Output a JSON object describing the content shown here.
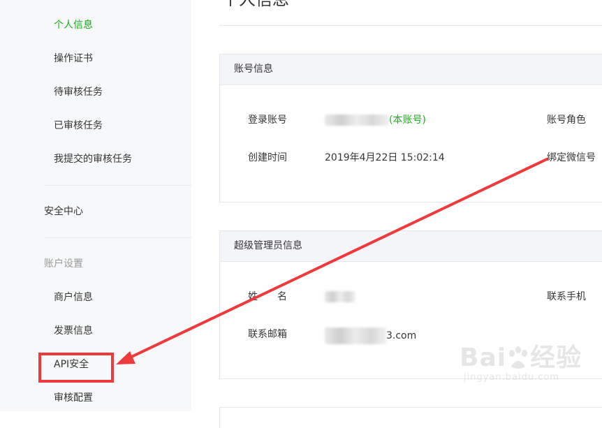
{
  "sidebar": {
    "items_top": [
      {
        "label": "个人信息",
        "active": true
      },
      {
        "label": "操作证书",
        "active": false
      },
      {
        "label": "待审核任务",
        "active": false
      },
      {
        "label": "已审核任务",
        "active": false
      },
      {
        "label": "我提交的审核任务",
        "active": false
      }
    ],
    "security_center": "安全中心",
    "account_settings_heading": "账户设置",
    "items_bottom": [
      {
        "label": "商户信息"
      },
      {
        "label": "发票信息"
      },
      {
        "label": "API安全"
      },
      {
        "label": "审核配置"
      }
    ]
  },
  "main": {
    "page_title": "个人信息",
    "account_panel": {
      "title": "账号信息",
      "login_account_label": "登录账号",
      "login_account_tag": "(本账号)",
      "created_label": "创建时间",
      "created_value": "2019年4月22日 15:02:14",
      "role_label": "账号角色",
      "wechat_label": "绑定微信号"
    },
    "admin_panel": {
      "title": "超级管理员信息",
      "name_label": "姓　　名",
      "email_label": "联系邮箱",
      "email_suffix": "3.com",
      "phone_label": "联系手机"
    }
  },
  "watermark": {
    "brand": "Bai",
    "brand_tail": "经验",
    "url": "jingyan.baidu.com"
  },
  "colors": {
    "accent": "#1aad19",
    "annotation": "#ee3a3a",
    "sidebar_bg": "#f6f8f9"
  }
}
